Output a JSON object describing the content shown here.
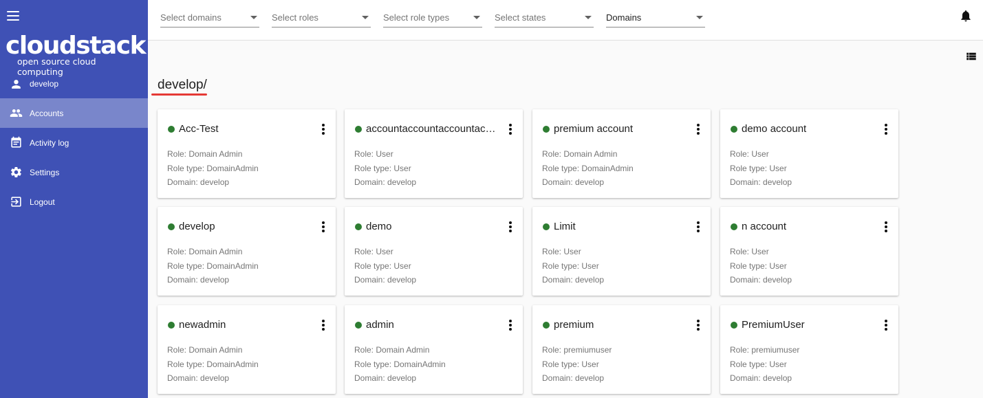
{
  "brand": {
    "name": "cloudstack",
    "tagline": "open source cloud computing"
  },
  "sidebar": {
    "user": "develop",
    "items": [
      {
        "label": "Accounts",
        "icon": "people-icon",
        "active": true
      },
      {
        "label": "Activity log",
        "icon": "calendar-icon",
        "active": false
      },
      {
        "label": "Settings",
        "icon": "gear-icon",
        "active": false
      },
      {
        "label": "Logout",
        "icon": "logout-icon",
        "active": false
      }
    ]
  },
  "filters": [
    {
      "label": "Select domains",
      "selected": false
    },
    {
      "label": "Select roles",
      "selected": false
    },
    {
      "label": "Select role types",
      "selected": false
    },
    {
      "label": "Select states",
      "selected": false
    },
    {
      "label": "Domains",
      "selected": true
    }
  ],
  "domain": {
    "path": "develop/"
  },
  "status_color": "#2e7d32",
  "accent_color": "#3f51b5",
  "accounts": [
    {
      "name": "Acc-Test",
      "role": "Role: Domain Admin",
      "role_type": "Role type: DomainAdmin",
      "domain": "Domain: develop"
    },
    {
      "name": "accountaccountaccountaccount",
      "role": "Role: User",
      "role_type": "Role type: User",
      "domain": "Domain: develop"
    },
    {
      "name": "premium account",
      "role": "Role: Domain Admin",
      "role_type": "Role type: DomainAdmin",
      "domain": "Domain: develop"
    },
    {
      "name": "demo account",
      "role": "Role: User",
      "role_type": "Role type: User",
      "domain": "Domain: develop"
    },
    {
      "name": "develop",
      "role": "Role: Domain Admin",
      "role_type": "Role type: DomainAdmin",
      "domain": "Domain: develop"
    },
    {
      "name": "demo",
      "role": "Role: User",
      "role_type": "Role type: User",
      "domain": "Domain: develop"
    },
    {
      "name": "Limit",
      "role": "Role: User",
      "role_type": "Role type: User",
      "domain": "Domain: develop"
    },
    {
      "name": "n account",
      "role": "Role: User",
      "role_type": "Role type: User",
      "domain": "Domain: develop"
    },
    {
      "name": "newadmin",
      "role": "Role: Domain Admin",
      "role_type": "Role type: DomainAdmin",
      "domain": "Domain: develop"
    },
    {
      "name": "admin",
      "role": "Role: Domain Admin",
      "role_type": "Role type: DomainAdmin",
      "domain": "Domain: develop"
    },
    {
      "name": "premium",
      "role": "Role: premiumuser",
      "role_type": "Role type: User",
      "domain": "Domain: develop"
    },
    {
      "name": "PremiumUser",
      "role": "Role: premiumuser",
      "role_type": "Role type: User",
      "domain": "Domain: develop"
    }
  ]
}
